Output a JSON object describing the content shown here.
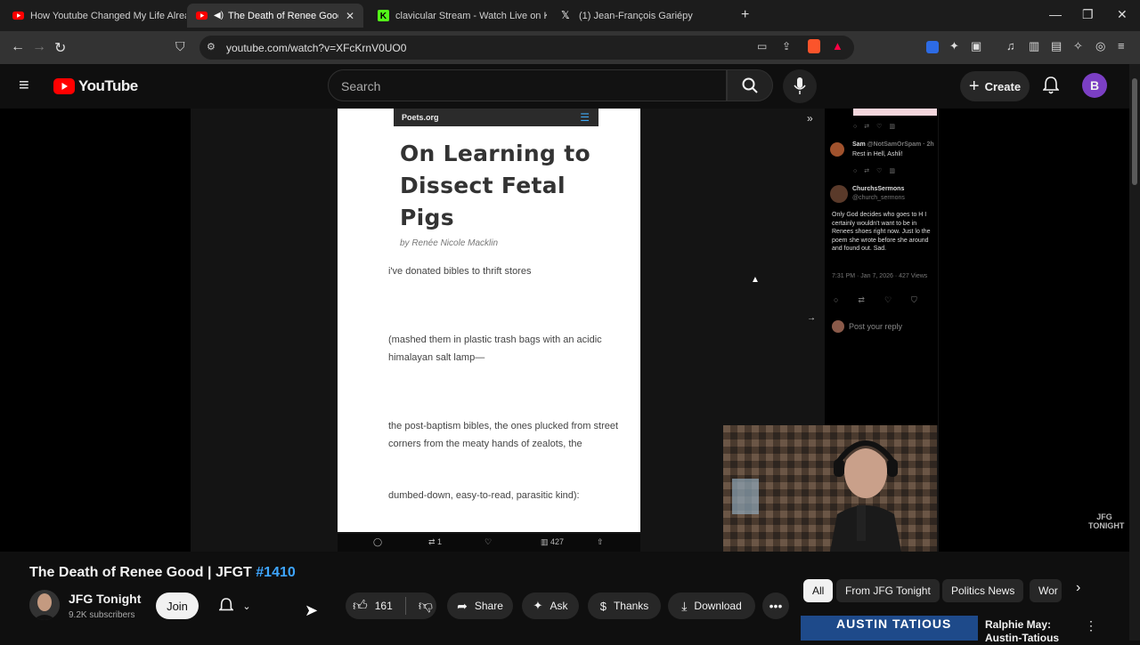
{
  "browser": {
    "tabs": [
      {
        "title": "How Youtube Changed My Life Alrea",
        "icon": "youtube-favicon"
      },
      {
        "title": "The Death of Renee Good | JF",
        "icon": "youtube-favicon",
        "active": true
      },
      {
        "title": "clavicular Stream - Watch Live on Kic",
        "icon": "kick-favicon"
      },
      {
        "title": "(1) Jean-François Gariépy",
        "icon": "x-favicon"
      }
    ],
    "url": "youtube.com/watch?v=XFcKrnV0UO0"
  },
  "youtube": {
    "logo_text": "YouTube",
    "search_placeholder": "Search",
    "create_label": "Create",
    "avatar_letter": "B"
  },
  "video_frame": {
    "site_name": "Poets.org",
    "poem_title": "On Learning to Dissect Fetal Pigs",
    "poem_author": "by Renée Nicole Macklin",
    "lines": [
      "i've donated bibles to thrift stores",
      "(mashed them in plastic trash bags with an acidic himalayan salt lamp—",
      "the post-baptism bibles, the ones plucked from street corners from the meaty hands of zealots, the",
      "dumbed-down, easy-to-read, parasitic kind):"
    ],
    "tweet_counts": {
      "retweets": "1",
      "views": "427"
    },
    "x_panel": {
      "tweet1_user": "Sam",
      "tweet1_handle": "@NotSamOrSpam · 2h",
      "tweet1_text": "Rest in Hell, Ashli!",
      "tweet2_user": "ChurchsSermons",
      "tweet2_handle": "@church_sermons",
      "tweet2_text": "Only God decides who goes to H I certainly wouldn't want to be in Renees shoes right now. Just lo the poem she wrote before she around and found out. Sad.",
      "tweet2_meta": "7:31 PM · Jan 7, 2026 · 427 Views",
      "reply_placeholder": "Post your reply"
    },
    "watermark": "JFG TONIGHT"
  },
  "video": {
    "title": "The Death of Renee Good | JFGT",
    "hashtag": "#1410",
    "channel_name": "JFG Tonight",
    "subscribers": "9.2K subscribers",
    "join_label": "Join",
    "like_count": "161",
    "share_label": "Share",
    "ask_label": "Ask",
    "thanks_label": "Thanks",
    "download_label": "Download"
  },
  "sidebar": {
    "chips": [
      "All",
      "From JFG Tonight",
      "Politics News",
      "Wor"
    ],
    "rec_title": "Ralphie May: Austin-Tatious",
    "rec_thumb_text": "AUSTIN TATIOUS"
  }
}
